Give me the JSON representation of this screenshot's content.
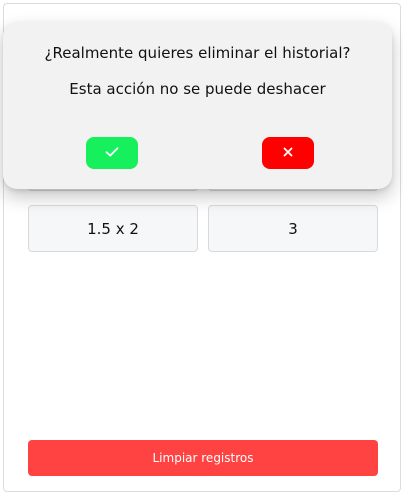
{
  "history": {
    "rows": [
      {
        "left": "",
        "right": ""
      },
      {
        "left": "1.5 x 2",
        "right": "3"
      }
    ]
  },
  "clear_button_label": "Limpiar registros",
  "dialog": {
    "title": "¿Realmente quieres eliminar el historial?",
    "message": "Esta acción no se puede deshacer",
    "confirm_icon": "check-icon",
    "cancel_icon": "close-icon"
  },
  "colors": {
    "confirm": "#17f05d",
    "cancel": "#ff0000",
    "clear_button": "#ff4242"
  }
}
